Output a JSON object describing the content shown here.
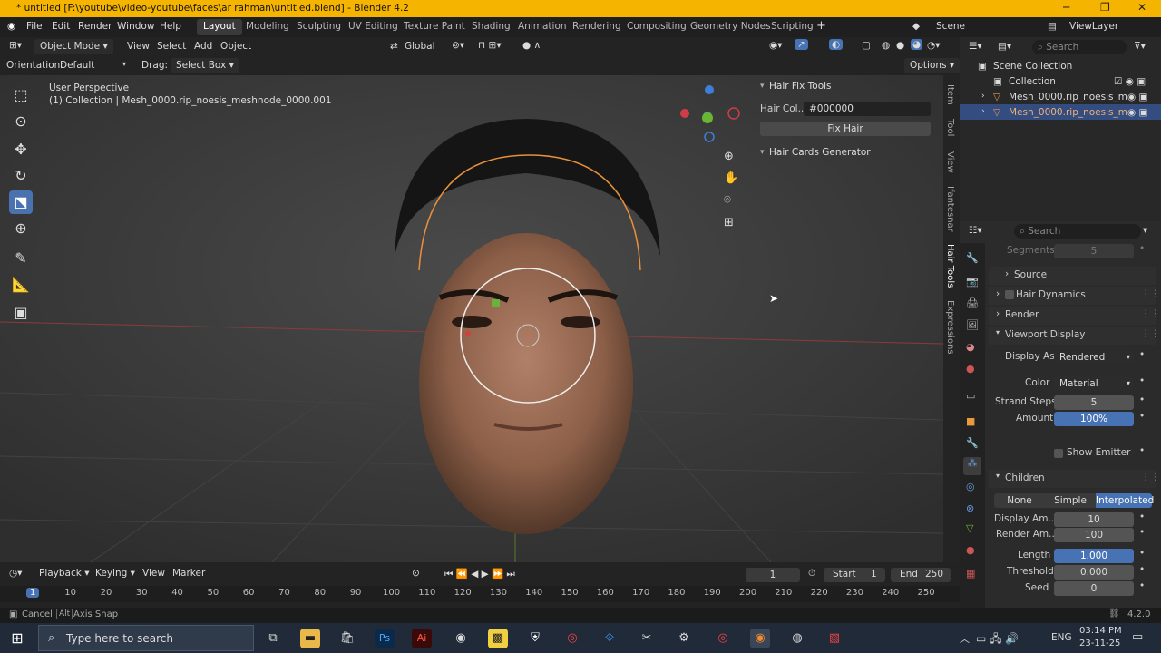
{
  "window": {
    "title": "* untitled [F:\\youtube\\video-youtube\\faces\\ar rahman\\untitled.blend] - Blender 4.2"
  },
  "menu": [
    "File",
    "Edit",
    "Render",
    "Window",
    "Help"
  ],
  "workspaces": [
    "Layout",
    "Modeling",
    "Sculpting",
    "UV Editing",
    "Texture Paint",
    "Shading",
    "Animation",
    "Rendering",
    "Compositing",
    "Geometry Nodes",
    "Scripting"
  ],
  "scene": "Scene",
  "view_layer": "ViewLayer",
  "header": {
    "mode": "Object Mode",
    "view": "View",
    "select": "Select",
    "add": "Add",
    "object": "Object",
    "orientation": "Global"
  },
  "toolsettings": {
    "orientation_label": "Orientation:",
    "orientation_value": "Default",
    "drag_label": "Drag:",
    "drag_value": "Select Box",
    "options": "Options"
  },
  "viewport": {
    "perspective": "User Perspective",
    "collection_info": "(1) Collection | Mesh_0000.rip_noesis_meshnode_0000.001"
  },
  "npanel": {
    "hair_fix_title": "Hair Fix Tools",
    "hair_color_label": "Hair Col...",
    "hair_color_value": "#000000",
    "fix_hair": "Fix Hair",
    "cards_title": "Hair Cards Generator"
  },
  "ntabs": [
    "Item",
    "Tool",
    "View",
    "Ifantesnar",
    "Hair Tools",
    "Expressions"
  ],
  "outliner": {
    "search": "Search",
    "scene_collection": "Scene Collection",
    "collection": "Collection",
    "items": [
      "Mesh_0000.rip_noesis_m",
      "Mesh_0000.rip_noesis_m"
    ]
  },
  "props": {
    "search": "Search",
    "segments_label": "Segments",
    "segments_value": "5",
    "source": "Source",
    "hair_dynamics": "Hair Dynamics",
    "render": "Render",
    "viewport_display": "Viewport Display",
    "display_as_label": "Display As",
    "display_as_value": "Rendered",
    "color_label": "Color",
    "color_value": "Material",
    "strand_steps_label": "Strand Steps",
    "strand_steps_value": "5",
    "amount_label": "Amount",
    "amount_value": "100%",
    "show_emitter": "Show Emitter",
    "children": "Children",
    "children_none": "None",
    "children_simple": "Simple",
    "children_interp": "Interpolated",
    "display_amount_label": "Display Am...",
    "display_amount_value": "10",
    "render_amount_label": "Render Am...",
    "render_amount_value": "100",
    "length_label": "Length",
    "length_value": "1.000",
    "threshold_label": "Threshold",
    "threshold_value": "0.000",
    "seed_label": "Seed",
    "seed_value": "0"
  },
  "timeline": {
    "playback": "Playback",
    "keying": "Keying",
    "view": "View",
    "marker": "Marker",
    "current_frame": "1",
    "start_label": "Start",
    "start_value": "1",
    "end_label": "End",
    "end_value": "250",
    "ticks": [
      "1",
      "10",
      "20",
      "30",
      "40",
      "50",
      "60",
      "70",
      "80",
      "90",
      "100",
      "110",
      "120",
      "130",
      "140",
      "150",
      "160",
      "170",
      "180",
      "190",
      "200",
      "210",
      "220",
      "230",
      "240",
      "250"
    ]
  },
  "status": {
    "cancel": "Cancel",
    "alt": "Alt",
    "axis_snap": "Axis Snap",
    "version": "4.2.0"
  },
  "taskbar": {
    "search_placeholder": "Type here to search",
    "lang": "ENG",
    "time": "03:14 PM",
    "date": "23-11-25"
  }
}
